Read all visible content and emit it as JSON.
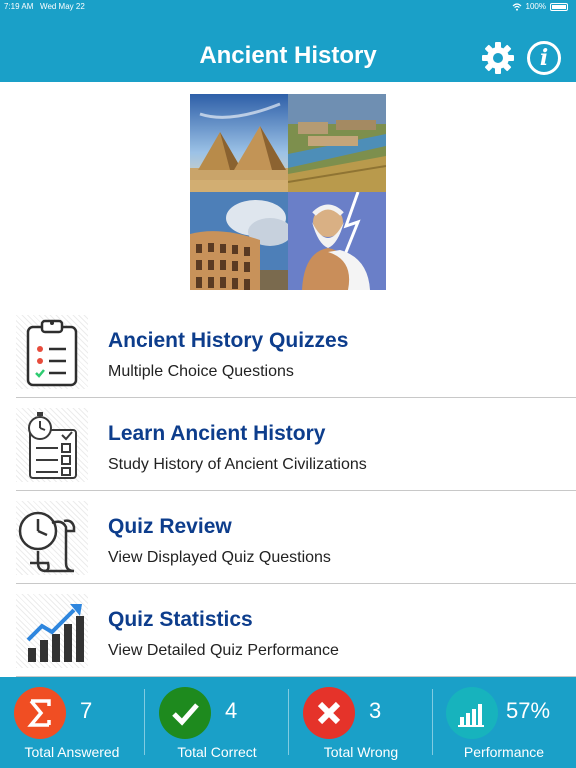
{
  "status_bar": {
    "time": "7:19 AM",
    "date": "Wed May 22",
    "battery": "100%"
  },
  "header": {
    "title": "Ancient History",
    "settings_icon": "gear-icon",
    "info_icon": "info-icon"
  },
  "collage": {
    "tiles": [
      "pyramids",
      "ancient-city-canal",
      "colosseum",
      "zeus"
    ]
  },
  "menu": [
    {
      "title": "Ancient History Quizzes",
      "subtitle": "Multiple Choice Questions",
      "icon": "clipboard-checklist-icon"
    },
    {
      "title": "Learn Ancient History",
      "subtitle": "Study History of Ancient Civilizations",
      "icon": "stopwatch-checklist-icon"
    },
    {
      "title": "Quiz Review",
      "subtitle": "View Displayed Quiz Questions",
      "icon": "clock-scroll-icon"
    },
    {
      "title": "Quiz Statistics",
      "subtitle": "View Detailed Quiz Performance",
      "icon": "bar-chart-trend-icon"
    }
  ],
  "stats": [
    {
      "label": "Total Answered",
      "value": "7",
      "icon": "sigma-icon",
      "color": "#f04e23"
    },
    {
      "label": "Total Correct",
      "value": "4",
      "icon": "checkmark-icon",
      "color": "#1e8a1e"
    },
    {
      "label": "Total Wrong",
      "value": "3",
      "icon": "x-mark-icon",
      "color": "#e5332a"
    },
    {
      "label": "Performance",
      "value": "57%",
      "icon": "bar-chart-icon",
      "color": "#17b3bd"
    }
  ],
  "colors": {
    "header_bg": "#1aa0c8",
    "menu_title": "#0d3d8c",
    "footer_bg": "#1aa0c8"
  }
}
